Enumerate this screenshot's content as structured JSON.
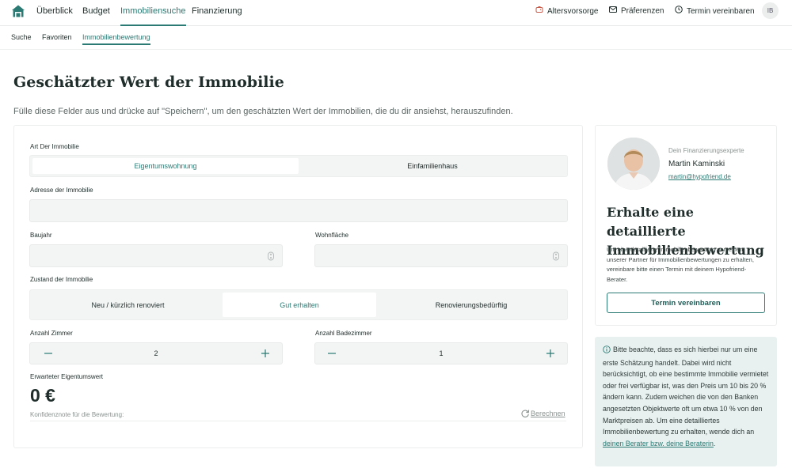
{
  "nav": {
    "items": [
      {
        "label": "Überblick"
      },
      {
        "label": "Budget"
      },
      {
        "label": "Immobiliensuche"
      },
      {
        "label": "Finanzierung"
      }
    ],
    "right": {
      "altersvorsorge": "Altersvorsorge",
      "praeferenzen": "Präferenzen",
      "termin": "Termin vereinbaren"
    },
    "avatar_initials": "IB"
  },
  "subnav": {
    "items": [
      {
        "label": "Suche"
      },
      {
        "label": "Favoriten"
      },
      {
        "label": "Immobilienbewertung"
      }
    ]
  },
  "page": {
    "title": "Geschätzter Wert der Immobilie",
    "description": "Fülle diese Felder aus und drücke auf \"Speichern\", um den geschätzten Wert der Immobilien, die du dir ansiehst, herauszufinden."
  },
  "form": {
    "art_label": "Art Der Immobilie",
    "art_options": [
      "Eigentumswohnung",
      "Einfamilienhaus"
    ],
    "adresse_label": "Adresse der Immobilie",
    "adresse_value": "",
    "baujahr_label": "Baujahr",
    "wohnflaeche_label": "Wohnfläche",
    "zustand_label": "Zustand der Immobilie",
    "zustand_options": [
      "Neu / kürzlich renoviert",
      "Gut erhalten",
      "Renovierungsbedürftig"
    ],
    "zimmer_label": "Anzahl Zimmer",
    "zimmer_value": "2",
    "bad_label": "Anzahl Badezimmer",
    "bad_value": "1",
    "ergebnis_label": "Erwarteter Eigentumswert",
    "ergebnis_value": "0 €",
    "konfidenz_label": "Konfidenznote für die Bewertung:",
    "berechnen": "Berechnen"
  },
  "expert": {
    "role": "Dein Finanzierungsexperte",
    "name": "Martin Kaminski",
    "email": "martin@hypofriend.de",
    "headline": "Erhalte eine detaillierte Immobilienbewertung",
    "text": "Um eine detaillierte Immobilienbewertung von einem unserer Partner für Immobilienbewertungen zu erhalten, vereinbare bitte einen Termin mit deinem Hypofriend-Berater.",
    "button": "Termin vereinbaren"
  },
  "note": {
    "text": "Bitte beachte, dass es sich hierbei nur um eine erste Schätzung handelt. Dabei wird nicht berücksichtigt, ob eine bestimmte Immobilie vermietet oder frei verfügbar ist, was den Preis um 10 bis 20 % ändern kann. Zudem weichen die von den Banken angesetzten Objektwerte oft um etwa 10 % von den Marktpreisen ab. Um eine detailliertes Immobilienbewertung zu erhalten, wende dich an",
    "link": "deinen Berater bzw. deine Beraterin",
    "end": "."
  },
  "colors": {
    "accent": "#2b7a73",
    "note_bg": "#e8f1f0",
    "field_bg": "#f3f4f4"
  }
}
